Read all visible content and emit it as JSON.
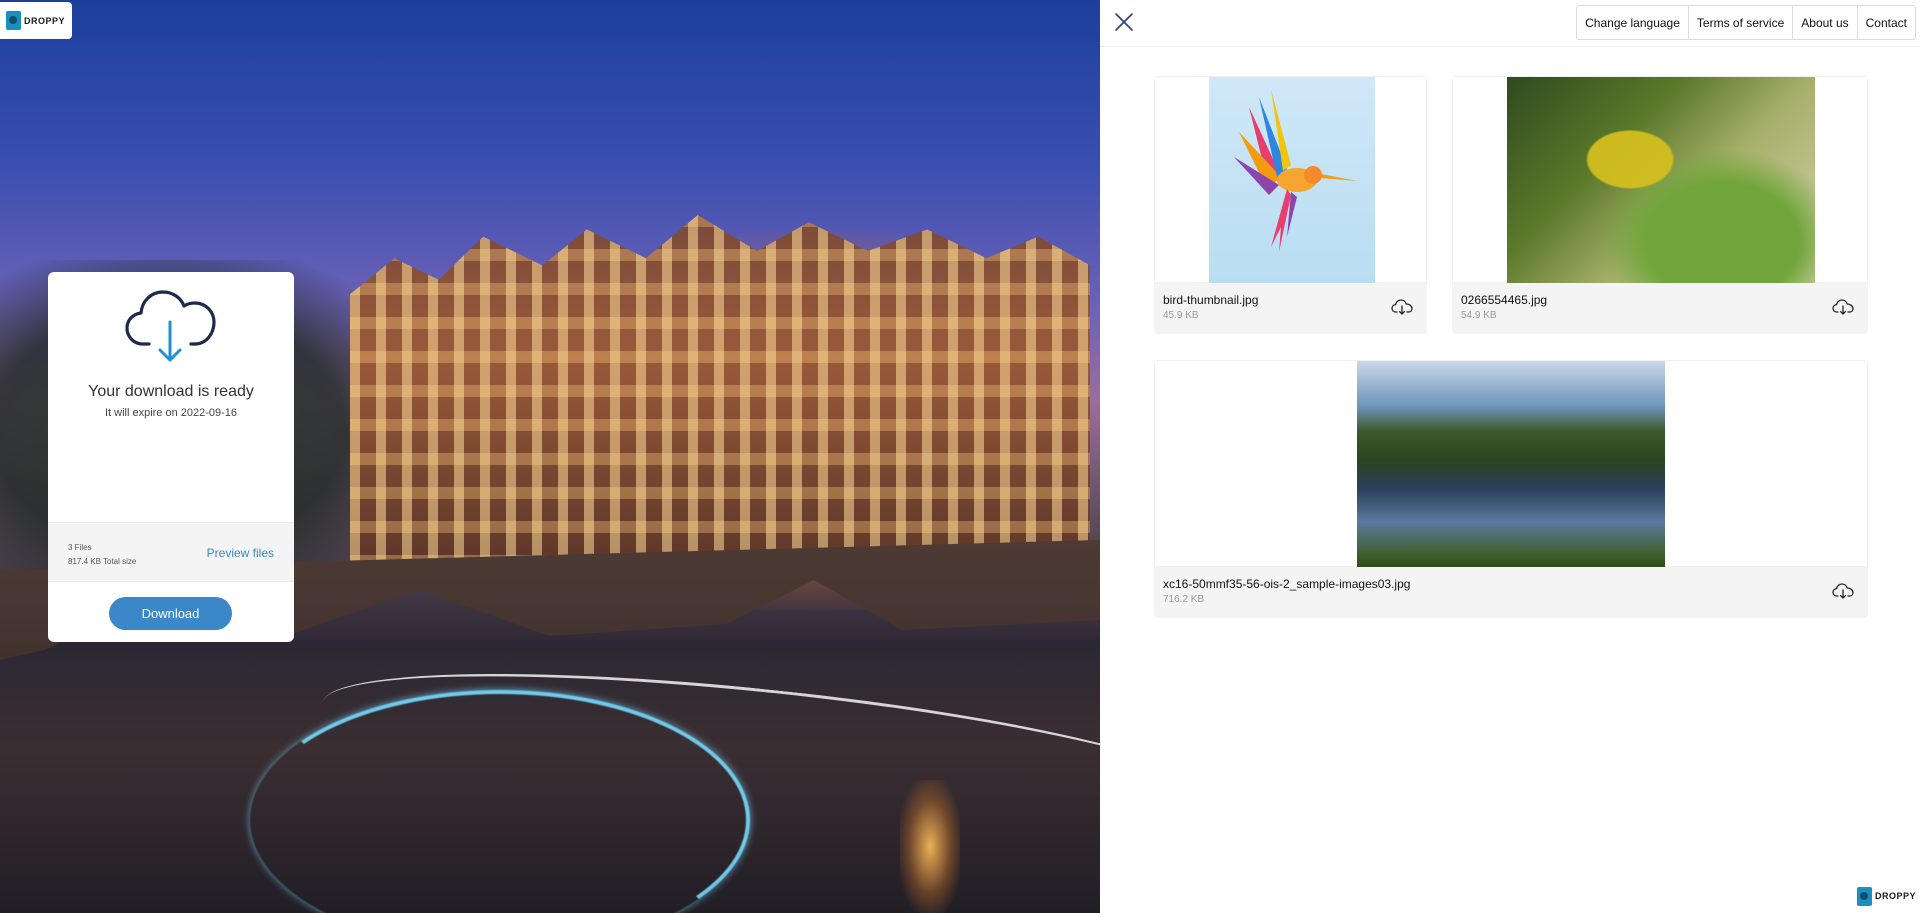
{
  "logo": {
    "text": "DROPPY"
  },
  "download_card": {
    "title": "Your download is ready",
    "subtitle": "It will expire on 2022-09-16",
    "files_count": "3 Files",
    "total_size": "817.4 KB Total size",
    "preview_label": "Preview files",
    "download_label": "Download"
  },
  "nav": {
    "items": [
      "Change language",
      "Terms of service",
      "About us",
      "Contact"
    ]
  },
  "files": [
    {
      "name": "bird-thumbnail.jpg",
      "size": "45.9 KB"
    },
    {
      "name": "0266554465.jpg",
      "size": "54.9 KB"
    },
    {
      "name": "xc16-50mmf35-56-ois-2_sample-images03.jpg",
      "size": "716.2 KB"
    }
  ],
  "colors": {
    "accent": "#3b87c8",
    "cloud_outline": "#1e2a4a",
    "arrow": "#1e90d6"
  },
  "icons": {
    "close": "close-icon",
    "cloud_download": "cloud-download-icon",
    "file_download": "download-icon"
  }
}
